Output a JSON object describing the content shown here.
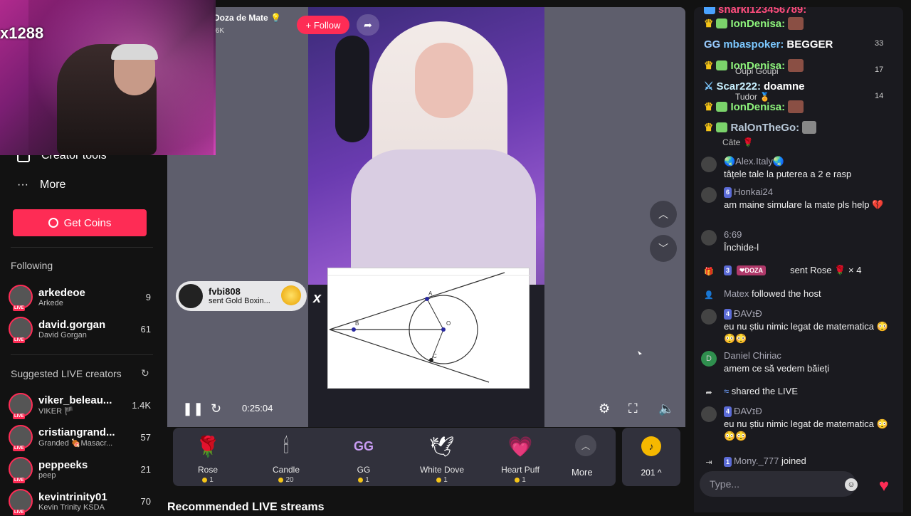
{
  "webcam": {
    "overlay_tag": "x1288"
  },
  "sidebar": {
    "creator_tools_label": "Creator tools",
    "more_label": "More",
    "get_coins_label": "Get Coins",
    "following_title": "Following",
    "following": [
      {
        "name": "arkedeoe",
        "sub": "Arkede",
        "count": "9"
      },
      {
        "name": "david.gorgan",
        "sub": "David Gorgan",
        "count": "61"
      }
    ],
    "suggested_title": "Suggested LIVE creators",
    "suggested": [
      {
        "name": "viker_beleau...",
        "sub": "VIKER 🏴",
        "count": "1.4K"
      },
      {
        "name": "cristiangrand...",
        "sub": "Granded 🍖Masacr...",
        "count": "57"
      },
      {
        "name": "peppeeks",
        "sub": "peep",
        "count": "21"
      },
      {
        "name": "kevintrinity01",
        "sub": "Kevin Trinity KSDA",
        "count": "70"
      }
    ],
    "live_tag": "LIVE"
  },
  "recommended_title": "Recommended LIVE streams",
  "player": {
    "host_name": "Doza de Mate 💡",
    "host_viewers": ".6K",
    "follow_label": "+ Follow",
    "time": "0:25:04",
    "gift_popup": {
      "user": "fvbi808",
      "text": "sent Gold Boxin...",
      "multiplier": "x"
    }
  },
  "gifts": [
    {
      "name": "Rose",
      "price": "1",
      "icon": "🌹"
    },
    {
      "name": "Candle",
      "price": "20",
      "icon": "🕯"
    },
    {
      "name": "GG",
      "price": "1",
      "icon": "GG"
    },
    {
      "name": "White Dove",
      "price": "1",
      "icon": "🕊"
    },
    {
      "name": "Heart Puff",
      "price": "1",
      "icon": "💗"
    }
  ],
  "gifts_more_label": "More",
  "coins_value": "201 ^",
  "chat": {
    "top_messages": [
      {
        "user": "sharki123456789:",
        "text": ""
      },
      {
        "user": "IonDenisa:",
        "text": ""
      },
      {
        "user": "mbaspoker:",
        "text": "BEGGER"
      },
      {
        "user": "IonDenisa:",
        "text": ""
      },
      {
        "user": "Scar222:",
        "text": "doamne"
      },
      {
        "user": "IonDenisa:",
        "text": ""
      },
      {
        "user": "RalOnTheGo:",
        "text": ""
      }
    ],
    "counters": [
      "33",
      "17",
      "14"
    ],
    "faded_names": [
      "Oupi Goupi",
      "Tudor 🏅",
      "Câte 🌹"
    ],
    "messages": [
      {
        "user": "🌏Alex.Italy🌏",
        "level": "",
        "text": "tâțele tale la puterea a 2 e rasp"
      },
      {
        "user": "Honkai24",
        "level": "6",
        "text": "am maine simulare la mate pls help 💔"
      },
      {
        "user": "6:69",
        "level": "",
        "text": "Închide-l"
      },
      {
        "user": "",
        "level": "3",
        "badge": "❤DOZA",
        "text": "sent Rose 🌹 × 4"
      },
      {
        "user": "Matex",
        "level": "",
        "text": "followed the host"
      },
      {
        "user": "ĐAVɪĐ",
        "level": "4",
        "text": "eu nu știu nimic legat de matematica 😳😳😳"
      },
      {
        "user": "Daniel Chiriac",
        "level": "",
        "avatar_letter": "D",
        "text": "amem ce să vedem băieți"
      },
      {
        "user": "",
        "level": "",
        "text": "shared the LIVE"
      },
      {
        "user": "ĐAVɪĐ",
        "level": "4",
        "text": "eu nu știu nimic legat de matematica 😳😳😳"
      },
      {
        "user": "Mony._777",
        "level": "1",
        "text": "joined"
      }
    ],
    "type_placeholder": "Type..."
  },
  "colors": {
    "accent": "#fe2c55",
    "background": "#121212",
    "panel": "#31313c"
  }
}
